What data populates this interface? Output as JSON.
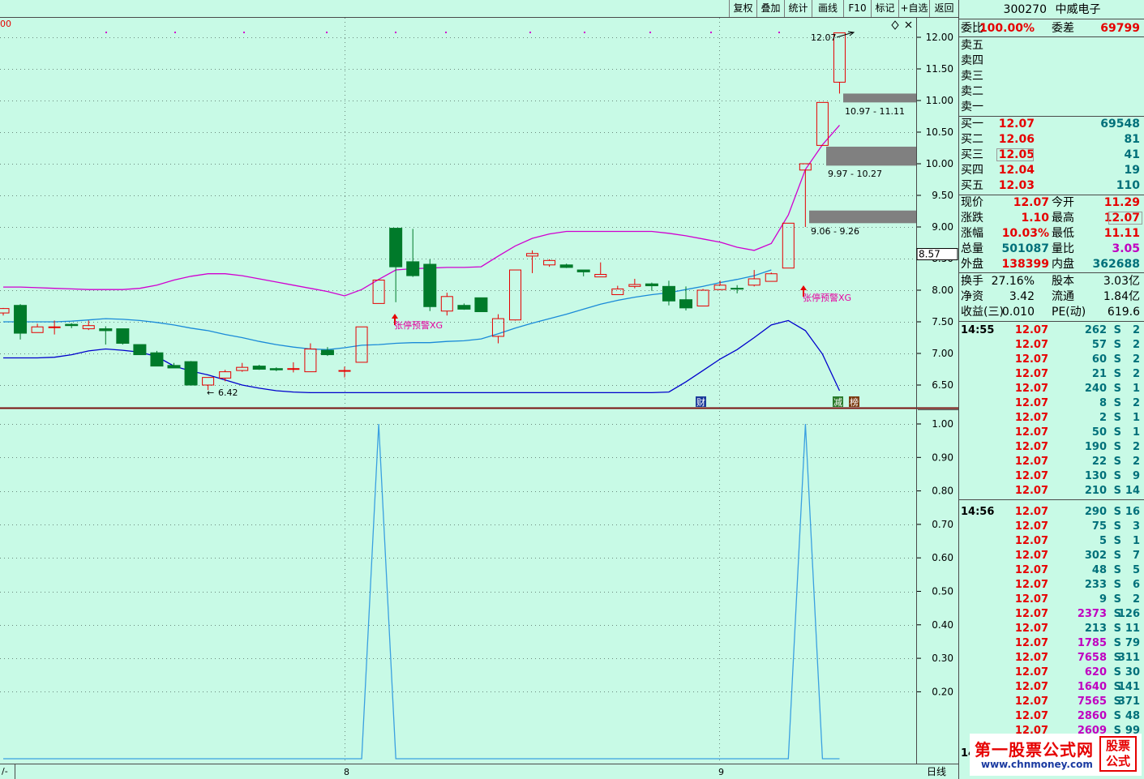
{
  "toolbar": {
    "buttons": [
      "复权",
      "叠加",
      "统计",
      "画线",
      "F10",
      "标记",
      "+自选",
      "返回"
    ]
  },
  "top_left_label": "00",
  "bottom_bar": {
    "left_label": "/-",
    "x_labels": [
      "8",
      "9"
    ],
    "period_label": "日线"
  },
  "colors": {
    "background": "#c8fae6",
    "up": "#e60000",
    "down": "#007a2a",
    "upper_band": "#d000d0",
    "mid_band": "#1a8ad8",
    "lower_band": "#0000cc",
    "indicator": "#3aa0e0"
  },
  "chart_data": {
    "type": "candlestick",
    "y_ticks": [
      "12.00",
      "11.50",
      "11.00",
      "10.50",
      "10.00",
      "9.50",
      "9.00",
      "8.50",
      "8.00",
      "7.50",
      "7.00",
      "6.50"
    ],
    "y_range": [
      6.2,
      12.1
    ],
    "current_price_label": "8.57",
    "candles": [
      {
        "o": 7.64,
        "h": 7.72,
        "l": 7.6,
        "c": 7.71
      },
      {
        "o": 7.76,
        "h": 7.78,
        "l": 7.22,
        "c": 7.32
      },
      {
        "o": 7.33,
        "h": 7.47,
        "l": 7.33,
        "c": 7.42
      },
      {
        "o": 7.42,
        "h": 7.52,
        "l": 7.3,
        "c": 7.42
      },
      {
        "o": 7.46,
        "h": 7.48,
        "l": 7.4,
        "c": 7.44
      },
      {
        "o": 7.39,
        "h": 7.52,
        "l": 7.37,
        "c": 7.44
      },
      {
        "o": 7.39,
        "h": 7.43,
        "l": 7.14,
        "c": 7.36
      },
      {
        "o": 7.39,
        "h": 7.39,
        "l": 7.14,
        "c": 7.16
      },
      {
        "o": 7.14,
        "h": 7.14,
        "l": 6.98,
        "c": 6.98
      },
      {
        "o": 7.01,
        "h": 7.04,
        "l": 6.8,
        "c": 6.8
      },
      {
        "o": 6.81,
        "h": 6.85,
        "l": 6.77,
        "c": 6.77
      },
      {
        "o": 6.87,
        "h": 6.88,
        "l": 6.5,
        "c": 6.5
      },
      {
        "o": 6.5,
        "h": 6.62,
        "l": 6.42,
        "c": 6.62
      },
      {
        "o": 6.61,
        "h": 6.74,
        "l": 6.56,
        "c": 6.71
      },
      {
        "o": 6.73,
        "h": 6.85,
        "l": 6.71,
        "c": 6.78
      },
      {
        "o": 6.8,
        "h": 6.82,
        "l": 6.74,
        "c": 6.75
      },
      {
        "o": 6.76,
        "h": 6.78,
        "l": 6.72,
        "c": 6.74
      },
      {
        "o": 6.75,
        "h": 6.86,
        "l": 6.7,
        "c": 6.76
      },
      {
        "o": 6.71,
        "h": 7.16,
        "l": 6.71,
        "c": 7.07
      },
      {
        "o": 7.05,
        "h": 7.1,
        "l": 6.96,
        "c": 6.98
      },
      {
        "o": 6.72,
        "h": 6.79,
        "l": 6.62,
        "c": 6.73
      },
      {
        "o": 6.86,
        "h": 7.42,
        "l": 6.86,
        "c": 7.42
      },
      {
        "o": 7.79,
        "h": 8.16,
        "l": 7.79,
        "c": 8.16
      },
      {
        "o": 8.98,
        "h": 8.98,
        "l": 7.81,
        "c": 8.37
      },
      {
        "o": 8.45,
        "h": 8.97,
        "l": 8.21,
        "c": 8.23
      },
      {
        "o": 8.41,
        "h": 8.49,
        "l": 7.67,
        "c": 7.74
      },
      {
        "o": 7.67,
        "h": 7.96,
        "l": 7.6,
        "c": 7.9
      },
      {
        "o": 7.76,
        "h": 7.79,
        "l": 7.69,
        "c": 7.7
      },
      {
        "o": 7.88,
        "h": 7.88,
        "l": 7.66,
        "c": 7.66
      },
      {
        "o": 7.27,
        "h": 7.62,
        "l": 7.16,
        "c": 7.55
      },
      {
        "o": 7.53,
        "h": 8.32,
        "l": 7.52,
        "c": 8.32
      },
      {
        "o": 8.54,
        "h": 8.63,
        "l": 8.27,
        "c": 8.58
      },
      {
        "o": 8.4,
        "h": 8.49,
        "l": 8.37,
        "c": 8.47
      },
      {
        "o": 8.4,
        "h": 8.42,
        "l": 8.35,
        "c": 8.36
      },
      {
        "o": 8.32,
        "h": 8.32,
        "l": 8.22,
        "c": 8.29
      },
      {
        "o": 8.21,
        "h": 8.44,
        "l": 8.21,
        "c": 8.25
      },
      {
        "o": 7.93,
        "h": 8.07,
        "l": 7.93,
        "c": 8.02
      },
      {
        "o": 8.06,
        "h": 8.18,
        "l": 8.03,
        "c": 8.09
      },
      {
        "o": 8.1,
        "h": 8.12,
        "l": 7.99,
        "c": 8.07
      },
      {
        "o": 8.06,
        "h": 8.15,
        "l": 7.76,
        "c": 7.83
      },
      {
        "o": 7.85,
        "h": 8.06,
        "l": 7.68,
        "c": 7.72
      },
      {
        "o": 7.75,
        "h": 8.02,
        "l": 7.75,
        "c": 8.0
      },
      {
        "o": 8.01,
        "h": 8.15,
        "l": 8.0,
        "c": 8.08
      },
      {
        "o": 8.03,
        "h": 8.08,
        "l": 7.95,
        "c": 8.02
      },
      {
        "o": 8.08,
        "h": 8.32,
        "l": 8.06,
        "c": 8.18
      },
      {
        "o": 8.14,
        "h": 8.28,
        "l": 8.14,
        "c": 8.26
      },
      {
        "o": 8.35,
        "h": 9.06,
        "l": 8.35,
        "c": 9.06
      },
      {
        "o": 9.9,
        "h": 10.0,
        "l": 9.0,
        "c": 10.0
      },
      {
        "o": 10.29,
        "h": 10.97,
        "l": 10.29,
        "c": 10.97
      },
      {
        "o": 11.29,
        "h": 12.07,
        "l": 11.11,
        "c": 12.07
      }
    ],
    "upper_band": [
      8.05,
      8.05,
      8.04,
      8.03,
      8.02,
      8.01,
      8.01,
      8.01,
      8.03,
      8.08,
      8.16,
      8.22,
      8.26,
      8.26,
      8.23,
      8.18,
      8.13,
      8.08,
      8.03,
      7.98,
      7.91,
      8.01,
      8.17,
      8.32,
      8.34,
      8.35,
      8.36,
      8.36,
      8.37,
      8.54,
      8.7,
      8.82,
      8.89,
      8.93,
      8.93,
      8.93,
      8.93,
      8.93,
      8.93,
      8.9,
      8.86,
      8.81,
      8.76,
      8.68,
      8.63,
      8.74,
      9.19,
      9.91,
      10.3,
      10.61
    ],
    "mid_band": [
      7.5,
      7.5,
      7.5,
      7.5,
      7.51,
      7.53,
      7.55,
      7.54,
      7.52,
      7.49,
      7.45,
      7.4,
      7.36,
      7.3,
      7.25,
      7.19,
      7.14,
      7.1,
      7.07,
      7.06,
      7.09,
      7.13,
      7.14,
      7.16,
      7.17,
      7.17,
      7.19,
      7.2,
      7.23,
      7.31,
      7.4,
      7.48,
      7.55,
      7.62,
      7.7,
      7.78,
      7.84,
      7.89,
      7.93,
      7.96,
      8.01,
      8.06,
      8.12,
      8.17,
      8.23,
      8.32
    ],
    "lower_band": [
      6.93,
      6.93,
      6.93,
      6.94,
      6.98,
      7.04,
      7.07,
      7.05,
      7.02,
      6.95,
      6.8,
      6.72,
      6.66,
      6.58,
      6.5,
      6.45,
      6.41,
      6.39,
      6.38,
      6.38,
      6.38,
      6.38,
      6.38,
      6.38,
      6.38,
      6.38,
      6.38,
      6.38,
      6.38,
      6.38,
      6.38,
      6.38,
      6.38,
      6.38,
      6.38,
      6.38,
      6.38,
      6.38,
      6.38,
      6.39,
      6.55,
      6.73,
      6.91,
      7.06,
      7.25,
      7.45,
      7.52,
      7.36,
      6.99,
      6.41
    ],
    "annotations": {
      "low_label": "6.42",
      "high_label": "12.07",
      "signals": [
        "张停预警XG",
        "张停预警XG"
      ],
      "gaps": [
        "10.97 - 11.11",
        "9.97 - 10.27",
        "9.06 - 9.26"
      ],
      "badges": [
        "财",
        "减",
        "榜"
      ]
    },
    "indicator_ticks": [
      "1.00",
      "0.90",
      "0.80",
      "0.70",
      "0.60",
      "0.50",
      "0.40",
      "0.30",
      "0.20"
    ],
    "indicator_values": [
      0,
      0,
      0,
      0,
      0,
      0,
      0,
      0,
      0,
      0,
      0,
      0,
      0,
      0,
      0,
      0,
      0,
      0,
      0,
      0,
      0,
      0,
      1,
      0,
      0,
      0,
      0,
      0,
      0,
      0,
      0,
      0,
      0,
      0,
      0,
      0,
      0,
      0,
      0,
      0,
      0,
      0,
      0,
      0,
      0,
      0,
      0,
      1,
      0,
      0
    ]
  },
  "quote": {
    "code": "300270",
    "name": "中威电子",
    "weibi_label": "委比",
    "weibi": "100.00%",
    "weicha_label": "委差",
    "weicha": "69799",
    "sells": [
      {
        "label": "卖五",
        "price": "",
        "vol": ""
      },
      {
        "label": "卖四",
        "price": "",
        "vol": ""
      },
      {
        "label": "卖三",
        "price": "",
        "vol": ""
      },
      {
        "label": "卖二",
        "price": "",
        "vol": ""
      },
      {
        "label": "卖一",
        "price": "",
        "vol": ""
      }
    ],
    "buys": [
      {
        "label": "买一",
        "price": "12.07",
        "vol": "69548"
      },
      {
        "label": "买二",
        "price": "12.06",
        "vol": "81"
      },
      {
        "label": "买三",
        "price": "12.05",
        "vol": "41"
      },
      {
        "label": "买四",
        "price": "12.04",
        "vol": "19"
      },
      {
        "label": "买五",
        "price": "12.03",
        "vol": "110"
      }
    ],
    "stats1": [
      {
        "l1": "现价",
        "v1": "12.07",
        "l2": "今开",
        "v2": "11.29"
      },
      {
        "l1": "涨跌",
        "v1": "1.10",
        "l2": "最高",
        "v2": "12.07"
      },
      {
        "l1": "涨幅",
        "v1": "10.03%",
        "l2": "最低",
        "v2": "11.11"
      },
      {
        "l1": "总量",
        "v1": "501087",
        "l2": "量比",
        "v2": "3.05"
      },
      {
        "l1": "外盘",
        "v1": "138399",
        "l2": "内盘",
        "v2": "362688"
      }
    ],
    "stats2": [
      {
        "l1": "换手",
        "v1": "27.16%",
        "l2": "股本",
        "v2": "3.03亿"
      },
      {
        "l1": "净资",
        "v1": "3.42",
        "l2": "流通",
        "v2": "1.84亿"
      },
      {
        "l1": "收益(三)",
        "v1": "0.010",
        "l2": "PE(动)",
        "v2": "619.6"
      }
    ]
  },
  "ticks": [
    {
      "time": "14:55",
      "price": "12.07",
      "vol": "262",
      "side": "S",
      "n": "2"
    },
    {
      "time": "",
      "price": "12.07",
      "vol": "57",
      "side": "S",
      "n": "2"
    },
    {
      "time": "",
      "price": "12.07",
      "vol": "60",
      "side": "S",
      "n": "2"
    },
    {
      "time": "",
      "price": "12.07",
      "vol": "21",
      "side": "S",
      "n": "2"
    },
    {
      "time": "",
      "price": "12.07",
      "vol": "240",
      "side": "S",
      "n": "1"
    },
    {
      "time": "",
      "price": "12.07",
      "vol": "8",
      "side": "S",
      "n": "2"
    },
    {
      "time": "",
      "price": "12.07",
      "vol": "2",
      "side": "S",
      "n": "1"
    },
    {
      "time": "",
      "price": "12.07",
      "vol": "50",
      "side": "S",
      "n": "1"
    },
    {
      "time": "",
      "price": "12.07",
      "vol": "190",
      "side": "S",
      "n": "2"
    },
    {
      "time": "",
      "price": "12.07",
      "vol": "22",
      "side": "S",
      "n": "2"
    },
    {
      "time": "",
      "price": "12.07",
      "vol": "130",
      "side": "S",
      "n": "9"
    },
    {
      "time": "",
      "price": "12.07",
      "vol": "210",
      "side": "S",
      "n": "14"
    },
    {
      "time": "14:56",
      "price": "12.07",
      "vol": "290",
      "side": "S",
      "n": "16"
    },
    {
      "time": "",
      "price": "12.07",
      "vol": "75",
      "side": "S",
      "n": "3"
    },
    {
      "time": "",
      "price": "12.07",
      "vol": "5",
      "side": "S",
      "n": "1"
    },
    {
      "time": "",
      "price": "12.07",
      "vol": "302",
      "side": "S",
      "n": "7"
    },
    {
      "time": "",
      "price": "12.07",
      "vol": "48",
      "side": "S",
      "n": "5"
    },
    {
      "time": "",
      "price": "12.07",
      "vol": "233",
      "side": "S",
      "n": "6"
    },
    {
      "time": "",
      "price": "12.07",
      "vol": "9",
      "side": "S",
      "n": "2"
    },
    {
      "time": "",
      "price": "12.07",
      "vol": "2373",
      "side": "S",
      "n": "126"
    },
    {
      "time": "",
      "price": "12.07",
      "vol": "213",
      "side": "S",
      "n": "11"
    },
    {
      "time": "",
      "price": "12.07",
      "vol": "1785",
      "side": "S",
      "n": "79"
    },
    {
      "time": "",
      "price": "12.07",
      "vol": "7658",
      "side": "S",
      "n": "311"
    },
    {
      "time": "",
      "price": "12.07",
      "vol": "620",
      "side": "S",
      "n": "30"
    },
    {
      "time": "",
      "price": "12.07",
      "vol": "1640",
      "side": "S",
      "n": "141"
    },
    {
      "time": "",
      "price": "12.07",
      "vol": "7565",
      "side": "S",
      "n": "371"
    },
    {
      "time": "",
      "price": "12.07",
      "vol": "2860",
      "side": "S",
      "n": "48"
    },
    {
      "time": "",
      "price": "12.07",
      "vol": "2609",
      "side": "S",
      "n": "99"
    }
  ],
  "tick_partial_time": "14",
  "watermark": {
    "line1": "第一股票公式网",
    "line2": "www.chnmoney.com",
    "badge": "股票公式"
  }
}
